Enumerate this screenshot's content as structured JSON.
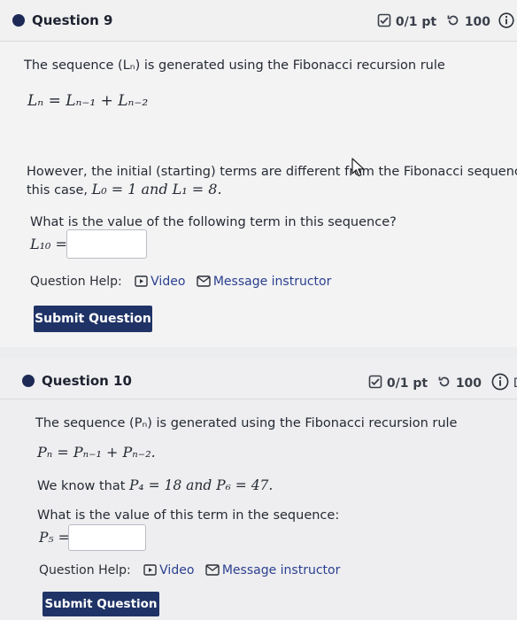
{
  "q9": {
    "title": "Question 9",
    "score": "0/1 pt",
    "attempts": "100",
    "intro": "The sequence (Lₙ) is generated using the Fibonacci recursion rule",
    "formula": "Lₙ = Lₙ₋₁ + Lₙ₋₂",
    "however_line1": "However, the initial (starting) terms are different from the Fibonacci sequence.",
    "however_line2_a": "this case, ",
    "however_line2_math": "L₀ = 1 and L₁ = 8.",
    "question": "What is the value of the following term in this sequence?",
    "term_label": "L₁₀ =",
    "help_label": "Question Help:",
    "video": "Video",
    "message": "Message instructor",
    "submit": "Submit Question"
  },
  "q10": {
    "title": "Question 10",
    "score": "0/1 pt",
    "attempts": "100",
    "details_partial": "De",
    "intro": "The sequence (Pₙ) is generated using the Fibonacci recursion rule",
    "formula": "Pₙ = Pₙ₋₁ + Pₙ₋₂.",
    "know_a": "We know that ",
    "know_math": "P₄ = 18 and P₆ = 47.",
    "question": "What is the value of this term in the sequence:",
    "term_label": "P₅ =",
    "help_label": "Question Help:",
    "video": "Video",
    "message": "Message instructor",
    "submit": "Submit Question"
  },
  "colors": {
    "accent": "#1f3366",
    "link": "#2a3f8f",
    "dot": "#1d2a55"
  }
}
